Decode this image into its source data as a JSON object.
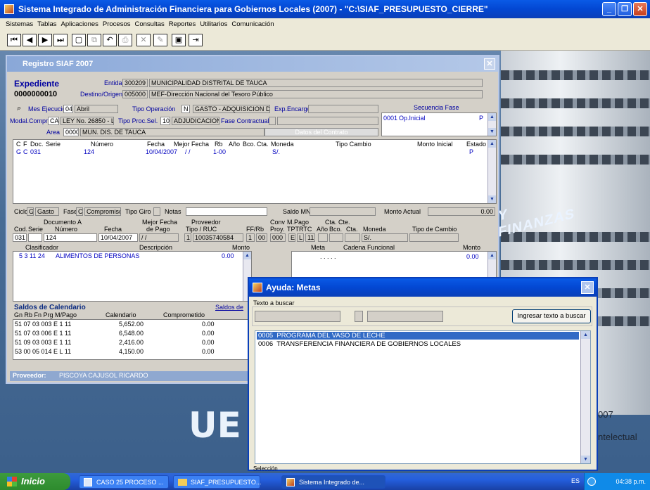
{
  "app": {
    "title": "Sistema Integrado de Administración Financiera para Gobiernos Locales (2007) - \"C:\\SIAF_PRESUPUESTO_CIERRE\"",
    "menu": [
      "Sistemas",
      "Tablas",
      "Aplicaciones",
      "Procesos",
      "Consultas",
      "Reportes",
      "Utilitarios",
      "Comunicación"
    ],
    "window_buttons": {
      "min": "_",
      "max": "❐",
      "close": "✕"
    }
  },
  "siaf": {
    "title": "Registro SIAF 2007",
    "expediente_label": "Expediente",
    "expediente_num": "0000000010",
    "entidad_label": "Entidad",
    "entidad_code": "300209",
    "entidad_name": "MUNICIPALIDAD DISTRITAL DE TAUCA",
    "destino_label": "Destino/Origen",
    "destino_code": "005000",
    "destino_name": "MEF-Dirección Nacional del Tesoro Público",
    "mes_label": "Mes Ejecución",
    "mes_code": "04",
    "mes_name": "Abril",
    "tipo_op_label": "Tipo Operación",
    "tipo_op_code": "N",
    "tipo_op_name": "GASTO - ADQUISICION D",
    "exp_encargo_label": "Exp.Encargo",
    "modal_label": "Modal.Compra",
    "modal_code": "CA",
    "modal_name": "LEY No. 26850 - L",
    "tipo_proc_label": "Tipo Proc.Sel.",
    "tipo_proc_code": "10",
    "tipo_proc_name": "ADJUDICACION D",
    "fase_contr_label": "Fase Contractual",
    "area_label": "Area",
    "area_code": "0000",
    "area_name": "MUN. DIS. DE TAUCA",
    "datos_contrato": "Datos del Contrato",
    "secuencia_label": "Secuencia Fase",
    "secuencia_num": "0001",
    "secuencia_name": "Op.Inicial",
    "secuencia_estado": "P",
    "grid_headers": [
      "C",
      "F",
      "Doc.",
      "Serie",
      "Número",
      "Fecha",
      "Mejor Fecha",
      "Rb",
      "Año",
      "Bco.",
      "Cta.",
      "Moneda",
      "Tipo Cambio",
      "Monto Inicial",
      "Estado"
    ],
    "grid_row": {
      "c": "G",
      "f": "C",
      "doc": "031",
      "numero": "124",
      "fecha": "10/04/2007",
      "mejor": "/ /",
      "rb": "1-00",
      "moneda": "S/.",
      "estado": "P"
    },
    "ciclo_label": "Ciclo",
    "ciclo_code": "G",
    "ciclo_name": "Gasto",
    "fase_label": "Fase",
    "fase_code": "C",
    "fase_name": "Compromiso",
    "tipo_giro_label": "Tipo Giro",
    "notas_label": "Notas",
    "saldo_mn_label": "Saldo MN",
    "monto_actual_label": "Monto Actual",
    "monto_actual": "0.00",
    "doc_a_label": "Documento A",
    "mejor_fecha_label": "Mejor Fecha",
    "de_pago_label": "de Pago",
    "proveedor_label": "Proveedor",
    "conv_label": "Conv",
    "mpago_label": "M.Pago",
    "cta_cte_label": "Cta. Cte.",
    "cod_label": "Cod.",
    "serie_label": "Serie",
    "numero_label": "Número",
    "fecha_label": "Fecha",
    "tipo_ruc_label": "Tipo / RUC",
    "ffrb_label": "FF/Rb",
    "proy_label": "Proy.",
    "tptrtc_label": "TPTRTC",
    "anio_label": "Año",
    "bco_label": "Bco.",
    "cta_label": "Cta.",
    "moneda_label": "Moneda",
    "tipo_cambio_label": "Tipo de Cambio",
    "doc_cod": "031",
    "doc_numero": "124",
    "doc_fecha": "10/04/2007",
    "doc_mejor": "/ /",
    "doc_tipo": "1",
    "doc_ruc": "10035740584",
    "doc_ff": "1",
    "doc_rb": "00",
    "doc_proy": "000",
    "doc_tp": "E",
    "doc_tr": "L",
    "doc_tc": "11",
    "doc_moneda": "S/.",
    "clasif_label": "Clasificador",
    "desc_label": "Descripción",
    "monto_label": "Monto",
    "clasif_code": "5 3 11 24",
    "clasif_desc": "ALIMENTOS DE PERSONAS",
    "clasif_monto": "0.00",
    "meta_label": "Meta",
    "cadena_label": "Cadena Funcional",
    "meta_dots": ". . . . .",
    "meta_monto": "0.00",
    "saldos_title": "Saldos de Calendario",
    "saldos_link": "Saldos de",
    "saldos_headers": [
      "Gn Rb Fn Prg M/Pago",
      "Calendario",
      "Comprometido"
    ],
    "saldos_rows": [
      {
        "k": "51 07 03 003 E 1 11",
        "cal": "5,652.00",
        "comp": "0.00"
      },
      {
        "k": "51 07 03 006 E 1 11",
        "cal": "6,548.00",
        "comp": "0.00"
      },
      {
        "k": "51 09 03 003 E 1 11",
        "cal": "2,416.00",
        "comp": "0.00"
      },
      {
        "k": "53 00 05 014 E L 11",
        "cal": "4,150.00",
        "comp": "0.00"
      }
    ],
    "proveedor_bar_label": "Proveedor:",
    "proveedor_name": "PISCOYA CAJUSOL RICARDO"
  },
  "ayuda": {
    "title": "Ayuda: Metas",
    "texto_label": "Texto a buscar",
    "button": "Ingresar texto a buscar",
    "items": [
      {
        "code": "0005",
        "name": "PROGRAMA DEL VASO DE LECHE"
      },
      {
        "code": "0006",
        "name": "TRANSFERENCIA FINANCIERA DE GOBIERNOS LOCALES"
      }
    ],
    "footer": "Selección"
  },
  "desktop": {
    "ue": "UE",
    "y2007": "007",
    "intelectual": "ntelectual",
    "sign": "Y FINANZAS"
  },
  "taskbar": {
    "start": "Inicio",
    "tasks": [
      "CASO 25 PROCESO ...",
      "SIAF_PRESUPUESTO...",
      "Sistema Integrado de..."
    ],
    "lang": "ES",
    "time": "04:38 p.m."
  },
  "colors": {
    "titlebar": "#0a5ae6",
    "form_bg": "#d4d0c8",
    "link": "#0000a0",
    "taskbar": "#245edc",
    "start": "#2e8b2e"
  }
}
